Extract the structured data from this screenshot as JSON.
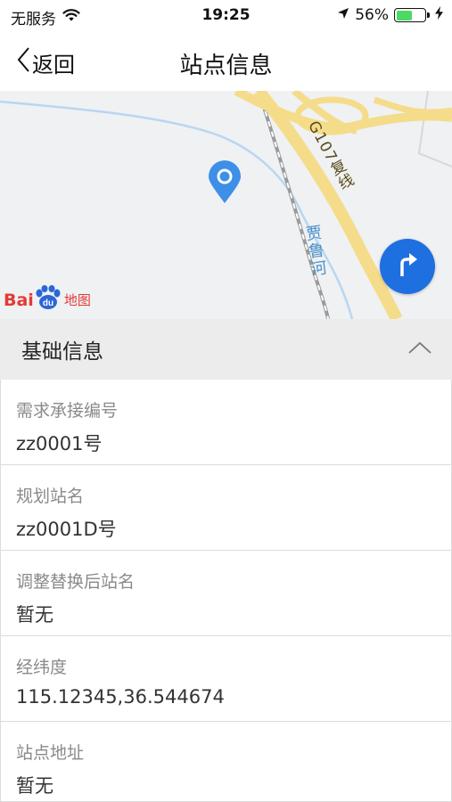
{
  "status_bar": {
    "carrier": "无服务",
    "time": "19:25",
    "battery_percent": "56%",
    "battery_level": 0.56,
    "battery_color": "#4cd964"
  },
  "nav": {
    "back_label": "返回",
    "title": "站点信息"
  },
  "map": {
    "road_label": "G107复线",
    "river_label": "贾鲁河",
    "logo_left": "Bai",
    "logo_paw": "du",
    "logo_right": "地图",
    "pin_color": "#3d8fe8",
    "locate_color": "#1e6fe0"
  },
  "section": {
    "title": "基础信息"
  },
  "fields": [
    {
      "label": "需求承接编号",
      "value": "zz0001号"
    },
    {
      "label": "规划站名",
      "value": "zz0001D号"
    },
    {
      "label": "调整替换后站名",
      "value": "暂无"
    },
    {
      "label": "经纬度",
      "value": "115.12345,36.544674"
    },
    {
      "label": "站点地址",
      "value": "暂无"
    }
  ],
  "icons": [
    "wifi-icon",
    "location-arrow-icon",
    "charging-icon",
    "back-chevron-icon",
    "map-pin-icon",
    "turn-right-icon",
    "chevron-up-icon"
  ]
}
